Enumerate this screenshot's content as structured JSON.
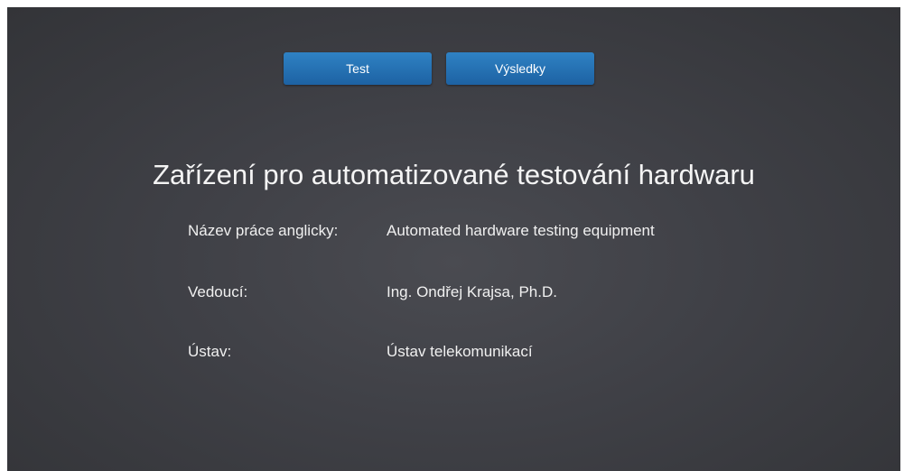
{
  "nav": {
    "test_label": "Test",
    "results_label": "Výsledky"
  },
  "page": {
    "title": "Zařízení pro automatizované testování hardwaru"
  },
  "details": [
    {
      "label": "Název práce anglicky:",
      "value": "Automated hardware testing equipment"
    },
    {
      "label": "Vedoucí:",
      "value": "Ing. Ondřej Krajsa, Ph.D."
    },
    {
      "label": "Ústav:",
      "value": "Ústav telekomunikací"
    }
  ],
  "colors": {
    "button": "#2674b6",
    "background": "#404147",
    "text": "#f2f2f2"
  }
}
